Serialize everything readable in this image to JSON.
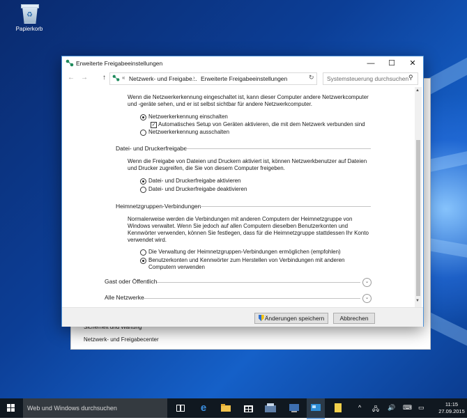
{
  "desktop": {
    "icons": [
      {
        "label": "Papierkorb",
        "icon": "recycle-bin-icon"
      }
    ]
  },
  "background_window": {
    "links": [
      "Sicherheit und Wartung",
      "Netzwerk- und Freigabecenter"
    ]
  },
  "window": {
    "title": "Erweiterte Freigabeeinstellungen",
    "controls": {
      "minimize": "—",
      "maximize": "☐",
      "close": "✕"
    },
    "address_bar": {
      "back": "←",
      "forward": "→",
      "up": "↑",
      "overflow": "«",
      "breadcrumbs": [
        "Netzwerk- und Freigabe...",
        "Erweiterte Freigabeeinstellungen"
      ],
      "separator": "›",
      "refresh": "↻",
      "search_placeholder": "Systemsteuerung durchsuchen"
    },
    "network_discovery": {
      "description": [
        "Wenn die Netzwerkerkennung eingeschaltet ist, kann dieser Computer andere Netzwerkcomputer",
        "und -geräte sehen, und er ist selbst sichtbar für andere Netzwerkcomputer."
      ],
      "option_on": "Netzwerkerkennung einschalten",
      "auto_setup": "Automatisches Setup von Geräten aktivieren, die mit dem Netzwerk verbunden sind",
      "option_off": "Netzwerkerkennung ausschalten",
      "selected": "on",
      "auto_setup_checked": true
    },
    "file_printer_sharing": {
      "heading": "Datei- und Druckerfreigabe",
      "description": [
        "Wenn die Freigabe von Dateien und Druckern aktiviert ist, können Netzwerkbenutzer auf Dateien",
        "und Drucker zugreifen, die Sie von diesem Computer freigeben."
      ],
      "option_on": "Datei- und Druckerfreigabe aktivieren",
      "option_off": "Datei- und Druckerfreigabe deaktivieren",
      "selected": "on"
    },
    "homegroup": {
      "heading": "Heimnetzgruppen-Verbindungen",
      "description": [
        "Normalerweise werden die Verbindungen mit anderen Computern der Heimnetzgruppe von",
        "Windows verwaltet. Wenn Sie jedoch auf allen Computern dieselben Benutzerkonten und",
        "Kennwörter verwenden, können Sie festlegen, dass für die Heimnetzgruppe stattdessen Ihr Konto",
        "verwendet wird."
      ],
      "option_windows": "Die Verwaltung der Heimnetzgruppen-Verbindungen ermöglichen (empfohlen)",
      "option_accounts": [
        "Benutzerkonten und Kennwörter zum Herstellen von Verbindungen mit anderen",
        "Computern verwenden"
      ],
      "selected": "accounts"
    },
    "profiles": [
      {
        "label": "Gast oder Öffentlich",
        "expander": "⌄"
      },
      {
        "label": "Alle Netzwerke",
        "expander": "⌄"
      }
    ],
    "buttons": {
      "save": "Änderungen speichern",
      "cancel": "Abbrechen"
    }
  },
  "taskbar": {
    "search_placeholder": "Web und Windows durchsuchen",
    "apps": [
      "task-view-icon",
      "edge-icon",
      "file-explorer-icon",
      "store-icon",
      "app-icon",
      "control-panel-icon",
      "notes-icon"
    ],
    "tray": {
      "up_arrow": "^",
      "speaker": "🔊",
      "notifications": "▭"
    },
    "time": "11:15",
    "date": "27.09.2015"
  },
  "colors": {
    "accent": "#4a8fd6",
    "taskbar": "#101820",
    "desktop": "#0c3e96"
  }
}
